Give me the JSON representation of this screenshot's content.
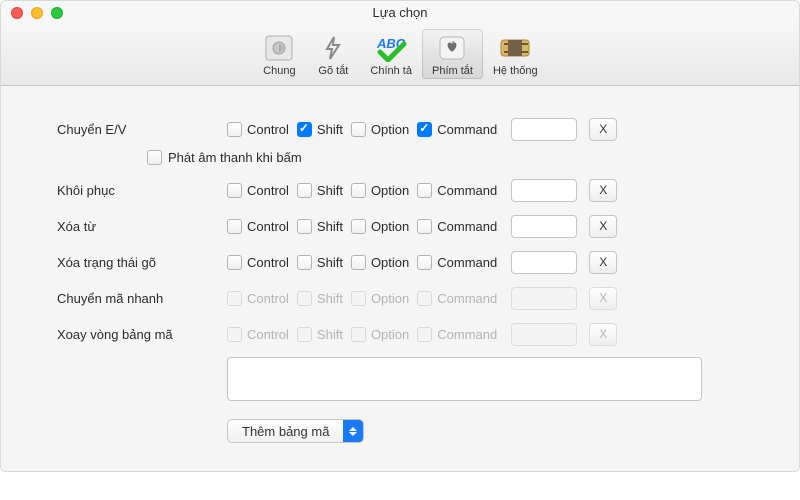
{
  "window": {
    "title": "Lựa chọn"
  },
  "toolbar": {
    "items": [
      {
        "label": "Chung"
      },
      {
        "label": "Gõ tắt"
      },
      {
        "label": "Chính tả"
      },
      {
        "label": "Phím tắt"
      },
      {
        "label": "Hệ thống"
      }
    ],
    "active_index": 3
  },
  "modifier_names": {
    "control": "Control",
    "shift": "Shift",
    "option": "Option",
    "command": "Command"
  },
  "rows": [
    {
      "label": "Chuyển E/V",
      "control": false,
      "shift": true,
      "option": false,
      "command": true,
      "key": "",
      "x": "X",
      "enabled": true,
      "has_sub": true
    },
    {
      "label": "Khôi phục",
      "control": false,
      "shift": false,
      "option": false,
      "command": false,
      "key": "",
      "x": "X",
      "enabled": true
    },
    {
      "label": "Xóa từ",
      "control": false,
      "shift": false,
      "option": false,
      "command": false,
      "key": "",
      "x": "X",
      "enabled": true
    },
    {
      "label": "Xóa trạng thái gõ",
      "control": false,
      "shift": false,
      "option": false,
      "command": false,
      "key": "",
      "x": "X",
      "enabled": true
    },
    {
      "label": "Chuyển mã nhanh",
      "control": false,
      "shift": false,
      "option": false,
      "command": false,
      "key": "",
      "x": "X",
      "enabled": false
    },
    {
      "label": "Xoay vòng bảng mã",
      "control": false,
      "shift": false,
      "option": false,
      "command": false,
      "key": "",
      "x": "X",
      "enabled": false
    }
  ],
  "sub_checkbox": {
    "checked": false,
    "label": "Phát âm thanh khi bấm"
  },
  "wide_field": {
    "value": ""
  },
  "select": {
    "selected": "Thêm bảng mã"
  }
}
